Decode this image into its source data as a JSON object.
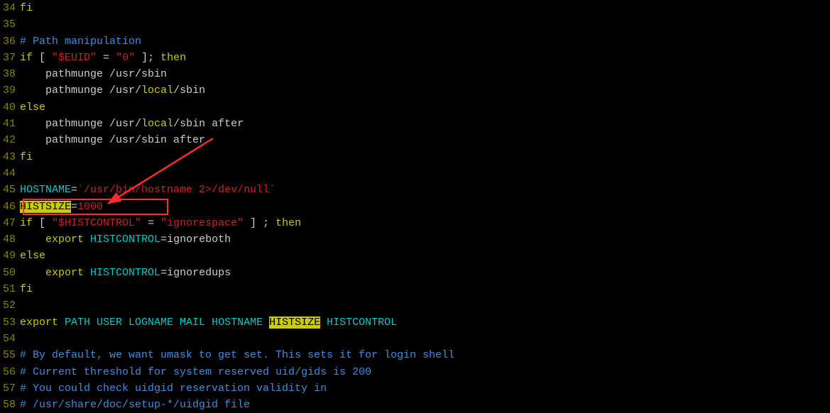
{
  "lines": [
    {
      "num": 34,
      "segs": [
        {
          "c": "t-keyword",
          "t": "fi"
        }
      ]
    },
    {
      "num": 35,
      "segs": []
    },
    {
      "num": 36,
      "segs": [
        {
          "c": "t-comment",
          "t": "# Path manipulation"
        }
      ]
    },
    {
      "num": 37,
      "segs": [
        {
          "c": "t-keyword",
          "t": "if"
        },
        {
          "c": "t-white",
          "t": " [ "
        },
        {
          "c": "t-str",
          "t": "\"$EUID\""
        },
        {
          "c": "t-white",
          "t": " = "
        },
        {
          "c": "t-str",
          "t": "\"0\""
        },
        {
          "c": "t-white",
          "t": " ]; "
        },
        {
          "c": "t-keyword",
          "t": "then"
        }
      ]
    },
    {
      "num": 38,
      "segs": [
        {
          "c": "t-white",
          "t": "    pathmunge "
        },
        {
          "c": "t-white",
          "t": "/usr/sbin"
        }
      ]
    },
    {
      "num": 39,
      "segs": [
        {
          "c": "t-white",
          "t": "    pathmunge "
        },
        {
          "c": "t-white",
          "t": "/usr/"
        },
        {
          "c": "t-local",
          "t": "local"
        },
        {
          "c": "t-white",
          "t": "/sbin"
        }
      ]
    },
    {
      "num": 40,
      "segs": [
        {
          "c": "t-keyword",
          "t": "else"
        }
      ]
    },
    {
      "num": 41,
      "segs": [
        {
          "c": "t-white",
          "t": "    pathmunge "
        },
        {
          "c": "t-white",
          "t": "/usr/"
        },
        {
          "c": "t-local",
          "t": "local"
        },
        {
          "c": "t-white",
          "t": "/sbin after"
        }
      ]
    },
    {
      "num": 42,
      "segs": [
        {
          "c": "t-white",
          "t": "    pathmunge "
        },
        {
          "c": "t-white",
          "t": "/usr/sbin after"
        }
      ]
    },
    {
      "num": 43,
      "segs": [
        {
          "c": "t-keyword",
          "t": "fi"
        }
      ]
    },
    {
      "num": 44,
      "segs": []
    },
    {
      "num": 45,
      "segs": [
        {
          "c": "t-cmd",
          "t": "HOSTNAME"
        },
        {
          "c": "t-white",
          "t": "="
        },
        {
          "c": "t-str",
          "t": "`/usr/bin/hostname 2>/dev/null`"
        }
      ]
    },
    {
      "num": 46,
      "segs": [
        {
          "c": "hl",
          "t": "HISTSIZE"
        },
        {
          "c": "t-white",
          "t": "="
        },
        {
          "c": "t-str",
          "t": "1000"
        }
      ]
    },
    {
      "num": 47,
      "segs": [
        {
          "c": "t-keyword",
          "t": "if"
        },
        {
          "c": "t-white",
          "t": " [ "
        },
        {
          "c": "t-str",
          "t": "\"$HISTCONTROL\""
        },
        {
          "c": "t-white",
          "t": " = "
        },
        {
          "c": "t-str",
          "t": "\"ignorespace\""
        },
        {
          "c": "t-white",
          "t": " ] ; "
        },
        {
          "c": "t-keyword",
          "t": "then"
        }
      ]
    },
    {
      "num": 48,
      "segs": [
        {
          "c": "t-white",
          "t": "    "
        },
        {
          "c": "t-keyword",
          "t": "export"
        },
        {
          "c": "t-white",
          "t": " "
        },
        {
          "c": "t-cmd",
          "t": "HISTCONTROL"
        },
        {
          "c": "t-white",
          "t": "=ignoreboth"
        }
      ]
    },
    {
      "num": 49,
      "segs": [
        {
          "c": "t-keyword",
          "t": "else"
        }
      ]
    },
    {
      "num": 50,
      "segs": [
        {
          "c": "t-white",
          "t": "    "
        },
        {
          "c": "t-keyword",
          "t": "export"
        },
        {
          "c": "t-white",
          "t": " "
        },
        {
          "c": "t-cmd",
          "t": "HISTCONTROL"
        },
        {
          "c": "t-white",
          "t": "=ignoredups"
        }
      ]
    },
    {
      "num": 51,
      "segs": [
        {
          "c": "t-keyword",
          "t": "fi"
        }
      ]
    },
    {
      "num": 52,
      "segs": []
    },
    {
      "num": 53,
      "segs": [
        {
          "c": "t-keyword",
          "t": "export"
        },
        {
          "c": "t-white",
          "t": " "
        },
        {
          "c": "t-cmd",
          "t": "PATH USER LOGNAME MAIL HOSTNAME "
        },
        {
          "c": "hl",
          "t": "HISTSIZE"
        },
        {
          "c": "t-cmd",
          "t": " HISTCONTROL"
        }
      ]
    },
    {
      "num": 54,
      "segs": []
    },
    {
      "num": 55,
      "segs": [
        {
          "c": "t-comment",
          "t": "# By default, we want umask to get set. This sets it for login shell"
        }
      ]
    },
    {
      "num": 56,
      "segs": [
        {
          "c": "t-comment",
          "t": "# Current threshold for system reserved uid/gids is 200"
        }
      ]
    },
    {
      "num": 57,
      "segs": [
        {
          "c": "t-comment",
          "t": "# You could check uidgid reservation validity in"
        }
      ]
    },
    {
      "num": 58,
      "segs": [
        {
          "c": "t-comment",
          "t": "# /usr/share/doc/setup-*/uidgid file"
        }
      ]
    }
  ],
  "highlight_term": "HISTSIZE",
  "annotation": {
    "box": {
      "line": 46,
      "target": "HISTSIZE=1000"
    },
    "arrow_color": "#ff2a2a"
  }
}
